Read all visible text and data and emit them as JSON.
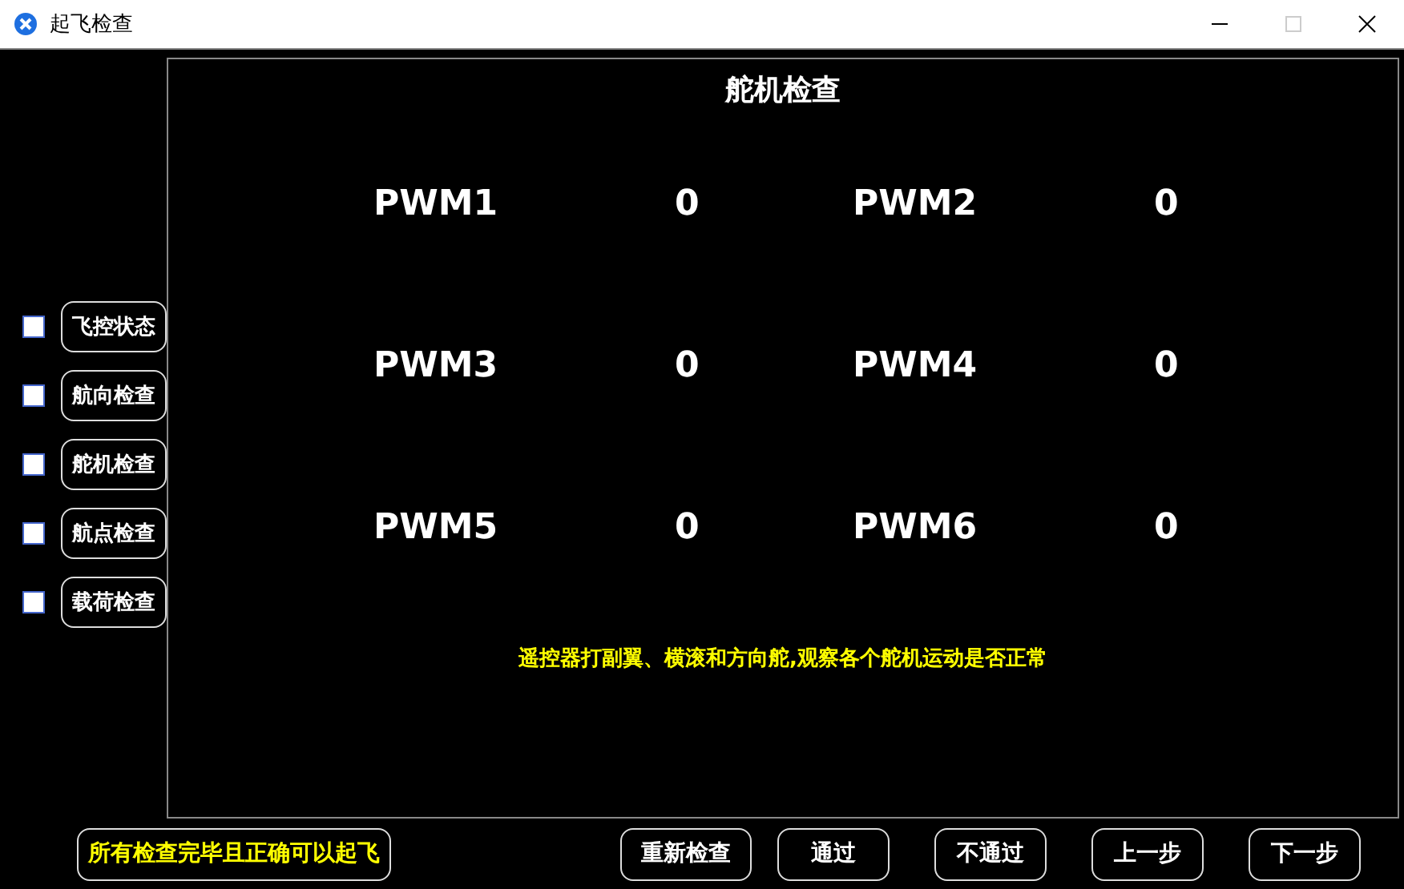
{
  "window": {
    "title": "起飞检查"
  },
  "checklist": [
    {
      "label": "飞控状态",
      "checked": false
    },
    {
      "label": "航向检查",
      "checked": false
    },
    {
      "label": "舵机检查",
      "checked": false
    },
    {
      "label": "航点检查",
      "checked": false
    },
    {
      "label": "载荷检查",
      "checked": false
    }
  ],
  "panel": {
    "title": "舵机检查",
    "readings": [
      {
        "label": "PWM1",
        "value": "0"
      },
      {
        "label": "PWM2",
        "value": "0"
      },
      {
        "label": "PWM3",
        "value": "0"
      },
      {
        "label": "PWM4",
        "value": "0"
      },
      {
        "label": "PWM5",
        "value": "0"
      },
      {
        "label": "PWM6",
        "value": "0"
      }
    ],
    "hint": "遥控器打副翼、横滚和方向舵,观察各个舵机运动是否正常"
  },
  "status": "所有检查完毕且正确可以起飞",
  "buttons": [
    "重新检查",
    "通过",
    "不通过",
    "上一步",
    "下一步"
  ]
}
